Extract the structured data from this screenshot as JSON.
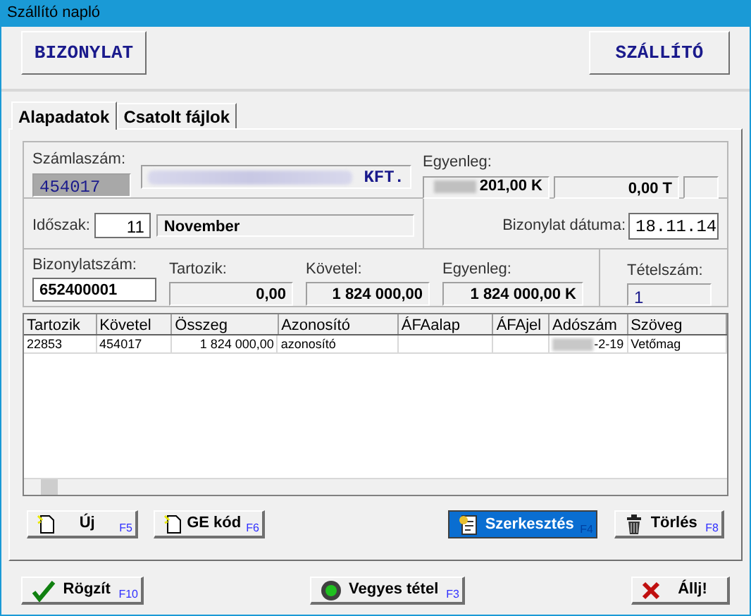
{
  "window": {
    "title": "Szállító napló"
  },
  "header": {
    "left": "BIZONYLAT",
    "right": "SZÁLLÍTÓ"
  },
  "tabs": [
    {
      "label": "Alapadatok",
      "selected": true
    },
    {
      "label": "Csatolt fájlok",
      "selected": false
    }
  ],
  "account": {
    "label": "Számlaszám:",
    "number": "454017",
    "name_suffix": "KFT.",
    "balance_label": "Egyenleg:",
    "balance": "201,00 K",
    "balance_2": "0,00 T"
  },
  "period": {
    "label": "Időszak:",
    "month_number": "11",
    "month_name": "November",
    "date_label": "Bizonylat dátuma:",
    "date": "18.11.14"
  },
  "document": {
    "number_label": "Bizonylatszám:",
    "number": "652400001",
    "debit_label": "Tartozik:",
    "debit": "0,00",
    "credit_label": "Követel:",
    "credit": "1 824 000,00",
    "balance_label": "Egyenleg:",
    "balance": "1 824 000,00 K",
    "items_label": "Tételszám:",
    "items": "1"
  },
  "table": {
    "columns": [
      "Tartozik",
      "Követel",
      "Összeg",
      "Azonosító",
      "ÁFAalap",
      "ÁFAjel",
      "Adószám",
      "Szöveg"
    ],
    "rows": [
      [
        "22853",
        "454017",
        "1 824 000,00",
        "azonosító",
        "",
        "",
        "-2-19",
        "Vetőmag"
      ]
    ]
  },
  "item_buttons": [
    {
      "kind": "new",
      "label": "Új",
      "key": "F5",
      "selected": false
    },
    {
      "kind": "new",
      "label": "GE kód",
      "key": "F6",
      "selected": false
    },
    {
      "kind": "edit",
      "label": "Szerkesztés",
      "key": "F4",
      "selected": true
    },
    {
      "kind": "delete",
      "label": "Törlés",
      "key": "F8",
      "selected": false
    }
  ],
  "footer_buttons": [
    {
      "kind": "save",
      "label": "Rögzít",
      "key": "F10"
    },
    {
      "kind": "mixed",
      "label": "Vegyes tétel",
      "key": "F3"
    },
    {
      "kind": "stop",
      "label": "Állj!"
    }
  ]
}
